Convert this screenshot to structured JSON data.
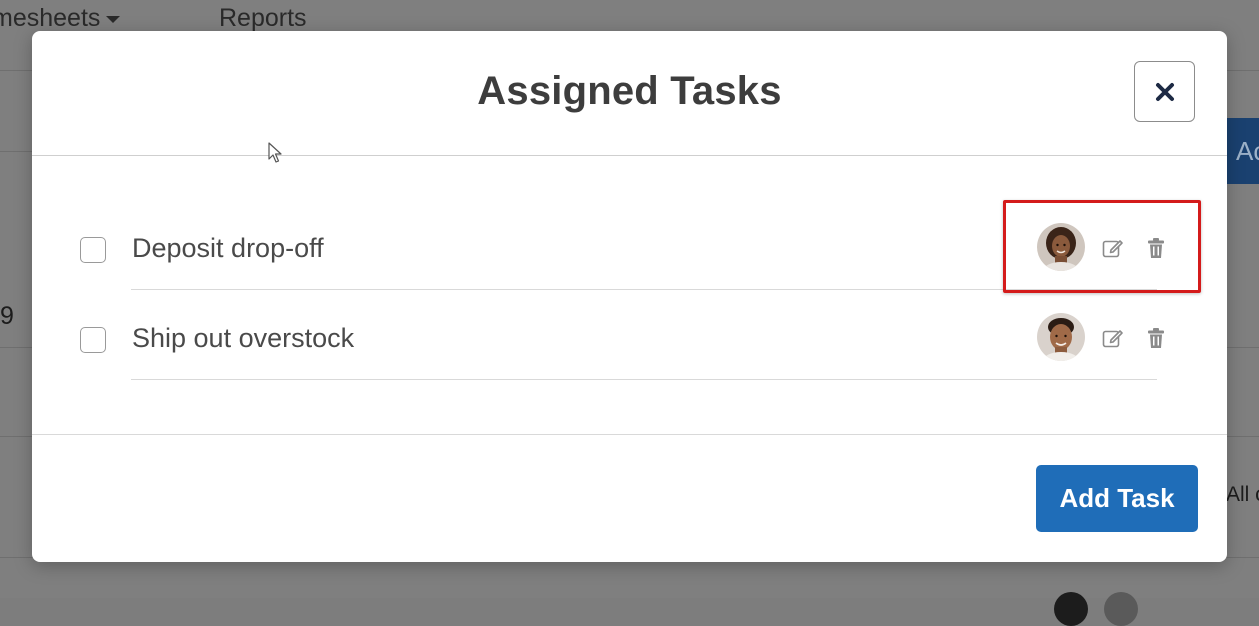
{
  "background": {
    "nav": {
      "timesheets_label": "mesheets",
      "reports_label": "Reports"
    },
    "side_button_label": "Ac",
    "row_number": "9",
    "side_text": "All c"
  },
  "modal": {
    "title": "Assigned Tasks",
    "close_icon": "close-icon",
    "tasks": [
      {
        "label": "Deposit drop-off",
        "checked": false,
        "assignee_avatar": "avatar-woman",
        "actions": [
          "edit-icon",
          "trash-icon"
        ]
      },
      {
        "label": "Ship out overstock",
        "checked": false,
        "assignee_avatar": "avatar-man",
        "actions": [
          "edit-icon",
          "trash-icon"
        ]
      }
    ],
    "add_task_label": "Add Task"
  },
  "colors": {
    "primary": "#1f6db8",
    "highlight": "#d41b1b",
    "overlay": "#7f7f7f"
  }
}
